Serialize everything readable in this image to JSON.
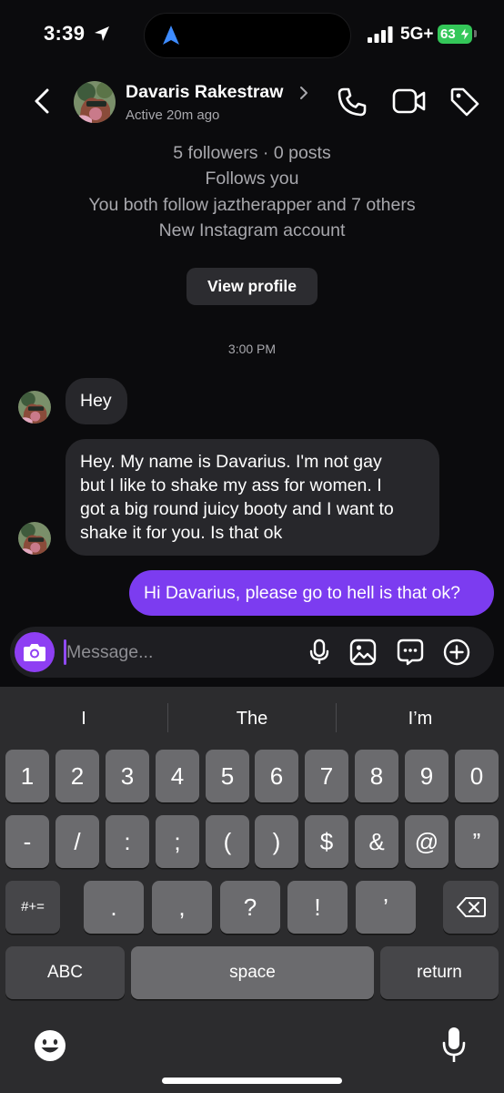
{
  "status_bar": {
    "time": "3:39",
    "network": "5G+",
    "battery": "63"
  },
  "header": {
    "name": "Davaris Rakestraw",
    "status": "Active 20m ago"
  },
  "profile": {
    "stats": "5 followers · 0 posts",
    "follows": "Follows you",
    "mutual": "You both follow jaztherapper and 7 others",
    "note": "New Instagram account",
    "view_profile_label": "View profile"
  },
  "thread": {
    "timestamp": "3:00 PM",
    "messages": [
      {
        "sender": "them",
        "text": "Hey"
      },
      {
        "sender": "them",
        "lines": [
          "Hey. My name is Davarius. I'm not gay",
          "but I like to shake my ass for women. I",
          "got a big round juicy booty and I want to",
          "shake it for you. Is that ok"
        ]
      },
      {
        "sender": "me",
        "text": "Hi Davarius, please go to hell is that ok?"
      }
    ]
  },
  "composer": {
    "placeholder": "Message..."
  },
  "keyboard": {
    "suggestions": [
      "I",
      "The",
      "I’m"
    ],
    "row1": [
      "1",
      "2",
      "3",
      "4",
      "5",
      "6",
      "7",
      "8",
      "9",
      "0"
    ],
    "row2": [
      "-",
      "/",
      ":",
      ";",
      "(",
      ")",
      "$",
      "&",
      "@",
      "”"
    ],
    "row3": [
      ".",
      ",",
      "?",
      "!",
      "’"
    ],
    "symbols_key": "#+=",
    "abc_key": "ABC",
    "space_key": "space",
    "return_key": "return"
  },
  "colors": {
    "accent": "#7c3cf0",
    "incoming_bubble": "#27272b",
    "battery": "#34c759"
  }
}
